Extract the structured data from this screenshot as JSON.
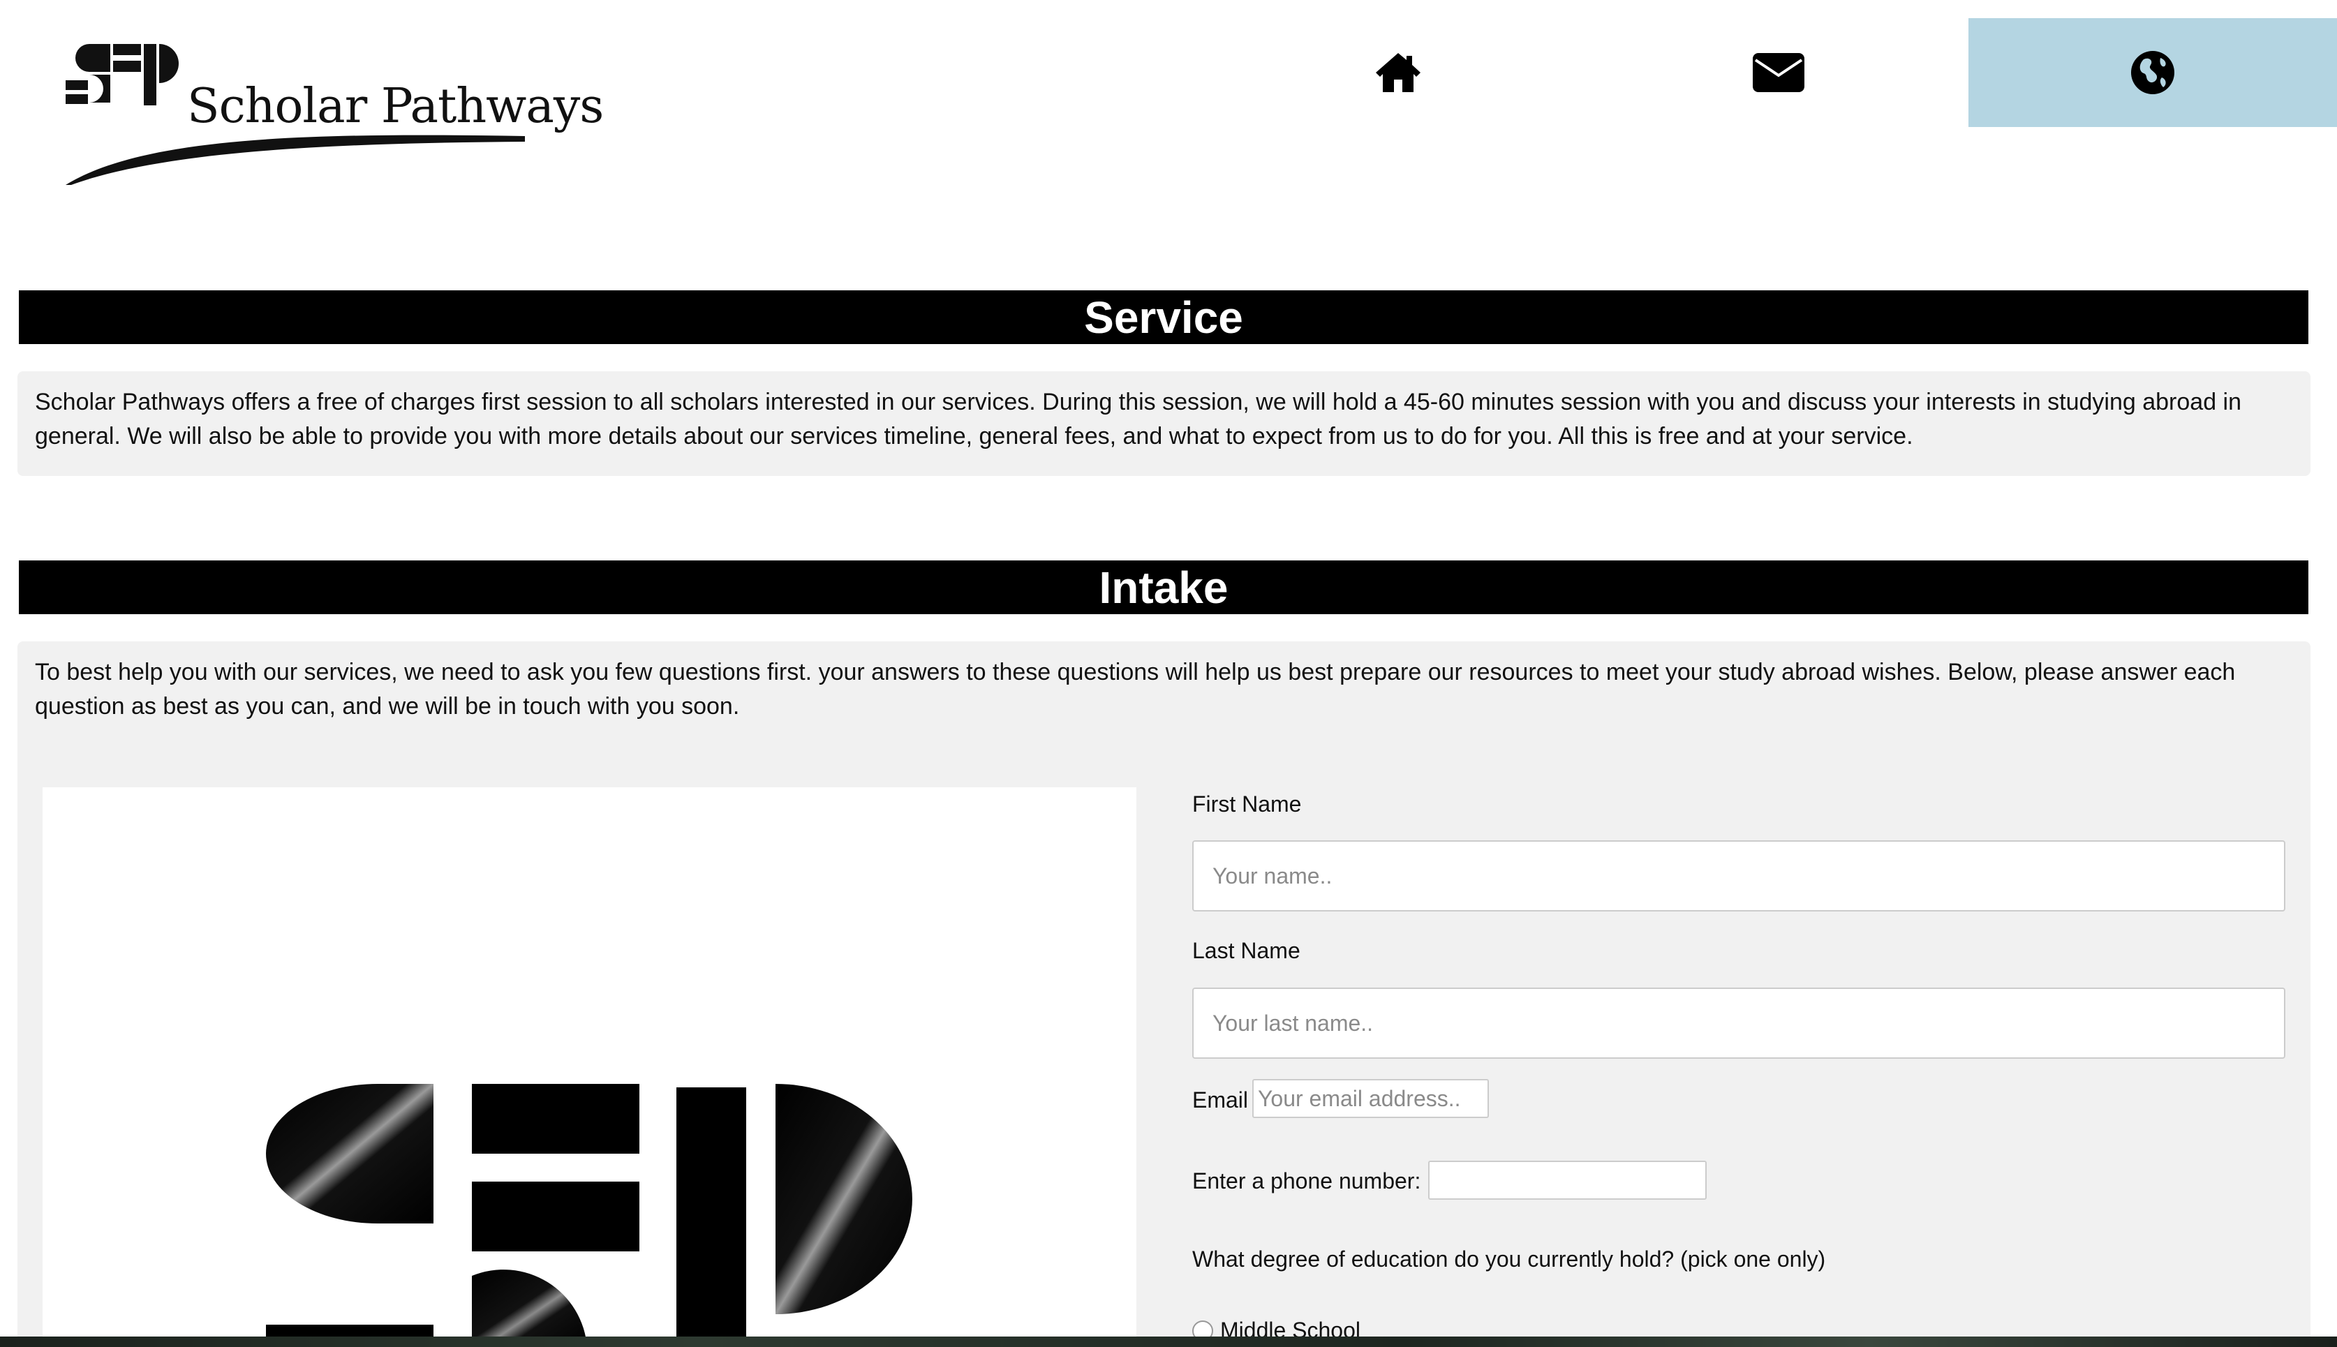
{
  "header": {
    "logo_text": "Scholar Pathways",
    "nav": {
      "home_icon": "home-icon",
      "mail_icon": "envelope-icon",
      "globe_icon": "globe-icon",
      "active_bg": "#b4d5e2"
    }
  },
  "service": {
    "title": "Service",
    "body": "Scholar Pathways offers a free of charges first session to all scholars interested in our services. During this session, we will hold a 45-60 minutes session with you and discuss your interests in studying abroad in general. We will also be able to provide you with more details about our services timeline, general fees, and what to expect from us to do for you. All this is free and at your service."
  },
  "intake": {
    "title": "Intake",
    "body": "To best help you with our services, we need to ask you few questions first. your answers to these questions will help us best prepare our resources to meet your study abroad wishes. Below, please answer each question as best as you can, and we will be in touch with you soon.",
    "form": {
      "first_name_label": "First Name",
      "first_name_placeholder": "Your name..",
      "last_name_label": "Last Name",
      "last_name_placeholder": "Your last name..",
      "email_label": "Email",
      "email_placeholder": "Your email address..",
      "phone_label": "Enter a phone number:",
      "degree_question": "What degree of education do you currently hold? (pick one only)",
      "degree_options": [
        "Middle School"
      ]
    }
  },
  "colors": {
    "section_bar": "#000000",
    "panel_bg": "#f1f1f1",
    "nav_active": "#b4d5e2"
  }
}
